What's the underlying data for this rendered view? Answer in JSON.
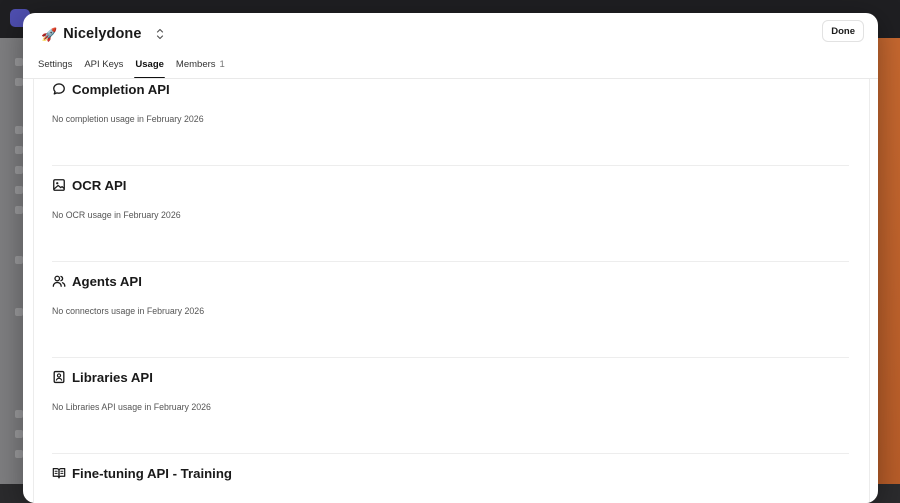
{
  "org": {
    "emoji": "🚀",
    "name": "Nicelydone"
  },
  "header": {
    "done_label": "Done"
  },
  "tabs": [
    {
      "label": "Settings",
      "active": false
    },
    {
      "label": "API Keys",
      "active": false
    },
    {
      "label": "Usage",
      "active": true
    },
    {
      "label": "Members",
      "active": false,
      "count": "1"
    }
  ],
  "usage_sections": [
    {
      "title": "Completion API",
      "icon": "chat-bubble-icon",
      "empty_text": "No completion usage in February 2026"
    },
    {
      "title": "OCR API",
      "icon": "image-icon",
      "empty_text": "No OCR usage in February 2026"
    },
    {
      "title": "Agents API",
      "icon": "users-icon",
      "empty_text": "No connectors usage in February 2026"
    },
    {
      "title": "Libraries API",
      "icon": "library-icon",
      "empty_text": "No Libraries API usage in February 2026"
    },
    {
      "title": "Fine-tuning API - Training",
      "icon": "book-open-icon",
      "empty_text": ""
    }
  ],
  "colors": {
    "accent_tab_underline": "#111111",
    "background_accent": "#c5672f"
  }
}
